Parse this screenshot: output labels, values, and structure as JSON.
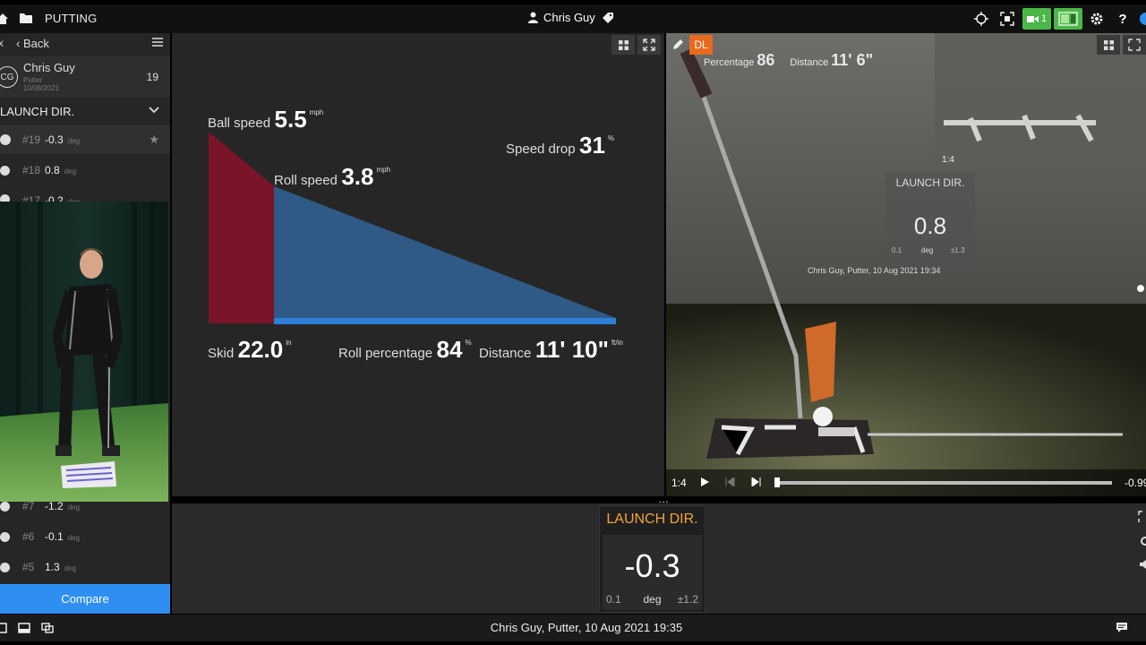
{
  "topbar": {
    "mode_title": "PUTTING",
    "user_name": "Chris Guy",
    "camera_count": "1"
  },
  "sidebar": {
    "close_label": "x",
    "back_label": "‹ Back",
    "player": {
      "initials": "CG",
      "name": "Chris Guy",
      "club": "Putter",
      "date": "10/08/2021",
      "shot_count": "19"
    },
    "metric_label": "LAUNCH DIR.",
    "shots_top": [
      {
        "num": "#19",
        "value": "-0.3",
        "unit": "deg",
        "starred": true
      },
      {
        "num": "#18",
        "value": "0.8",
        "unit": "deg",
        "starred": false
      },
      {
        "num": "#17",
        "value": "-0.2",
        "unit": "deg",
        "starred": false
      }
    ],
    "shots_bottom": [
      {
        "num": "#7",
        "value": "-1.2",
        "unit": "deg"
      },
      {
        "num": "#6",
        "value": "-0.1",
        "unit": "deg"
      },
      {
        "num": "#5",
        "value": "1.3",
        "unit": "deg"
      }
    ],
    "compare_label": "Compare"
  },
  "chart": {
    "ball_speed": {
      "label": "Ball speed",
      "value": "5.5",
      "unit": "mph"
    },
    "roll_speed": {
      "label": "Roll speed",
      "value": "3.8",
      "unit": "mph"
    },
    "speed_drop": {
      "label": "Speed drop",
      "value": "31",
      "unit": "%"
    },
    "skid": {
      "label": "Skid",
      "value": "22.0",
      "unit": "in"
    },
    "roll_percentage": {
      "label": "Roll percentage",
      "value": "84",
      "unit": "%"
    },
    "distance": {
      "label": "Distance",
      "value": "11' 10\"",
      "unit": "ft/in"
    },
    "colors": {
      "skid": "#7a1428",
      "roll": "#2f5a85",
      "roll_line": "#2f7fd6"
    }
  },
  "video": {
    "dl_label": "DL",
    "overlay_percentage": "86",
    "overlay_percentage_label": "Percentage",
    "overlay_distance_label": "Distance",
    "overlay_distance": "11' 6\"",
    "overlay_launch_label": "LAUNCH DIR.",
    "overlay_launch_value": "0.8",
    "overlay_launch_min": "0.1",
    "overlay_launch_unit": "deg",
    "overlay_launch_tol": "±1.3",
    "overlay_caption": "Chris Guy, Putter, 10 Aug 2021 19:34",
    "overlay_speed": "1:4",
    "speed": "1:4",
    "time": "-0.99"
  },
  "tile": {
    "title": "LAUNCH DIR.",
    "value": "-0.3",
    "min": "0.1",
    "unit": "deg",
    "tolerance": "±1.2"
  },
  "footer": {
    "caption": "Chris Guy, Putter, 10 Aug 2021 19:35"
  }
}
